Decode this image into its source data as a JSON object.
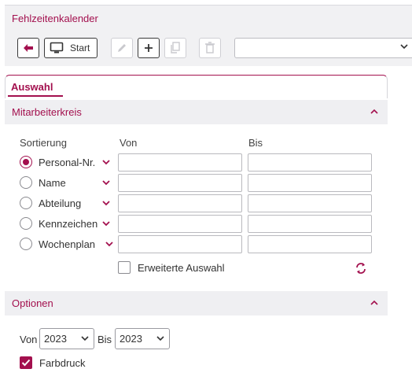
{
  "window": {
    "title": "Fehlzeitenkalender"
  },
  "toolbar": {
    "start_label": "Start",
    "view_select_value": ""
  },
  "tabs": [
    {
      "label": "Auswahl"
    }
  ],
  "mitarbeiterkreis": {
    "title": "Mitarbeiterkreis",
    "col_sort": "Sortierung",
    "col_von": "Von",
    "col_bis": "Bis",
    "rows": [
      {
        "label": "Personal-Nr.",
        "checked": true,
        "von": "",
        "bis": ""
      },
      {
        "label": "Name",
        "checked": false,
        "von": "",
        "bis": ""
      },
      {
        "label": "Abteilung",
        "checked": false,
        "von": "",
        "bis": ""
      },
      {
        "label": "Kennzeichen",
        "checked": false,
        "von": "",
        "bis": ""
      },
      {
        "label": "Wochenplan",
        "checked": false,
        "von": "",
        "bis": ""
      }
    ],
    "extended_label": "Erweiterte Auswahl",
    "extended_checked": false
  },
  "optionen": {
    "title": "Optionen",
    "von_label": "Von",
    "von_year": "2023",
    "bis_label": "Bis",
    "bis_year": "2023",
    "farbdruck_label": "Farbdruck",
    "farbdruck_checked": true
  },
  "colors": {
    "accent": "#a3104e",
    "panel": "#f1f1f3"
  },
  "icons": [
    "back-arrow-icon",
    "monitor-icon",
    "pencil-icon",
    "plus-icon",
    "copy-icon",
    "trash-icon",
    "chevron-down-icon",
    "chevron-up-icon",
    "refresh-icon",
    "checkmark-icon"
  ]
}
